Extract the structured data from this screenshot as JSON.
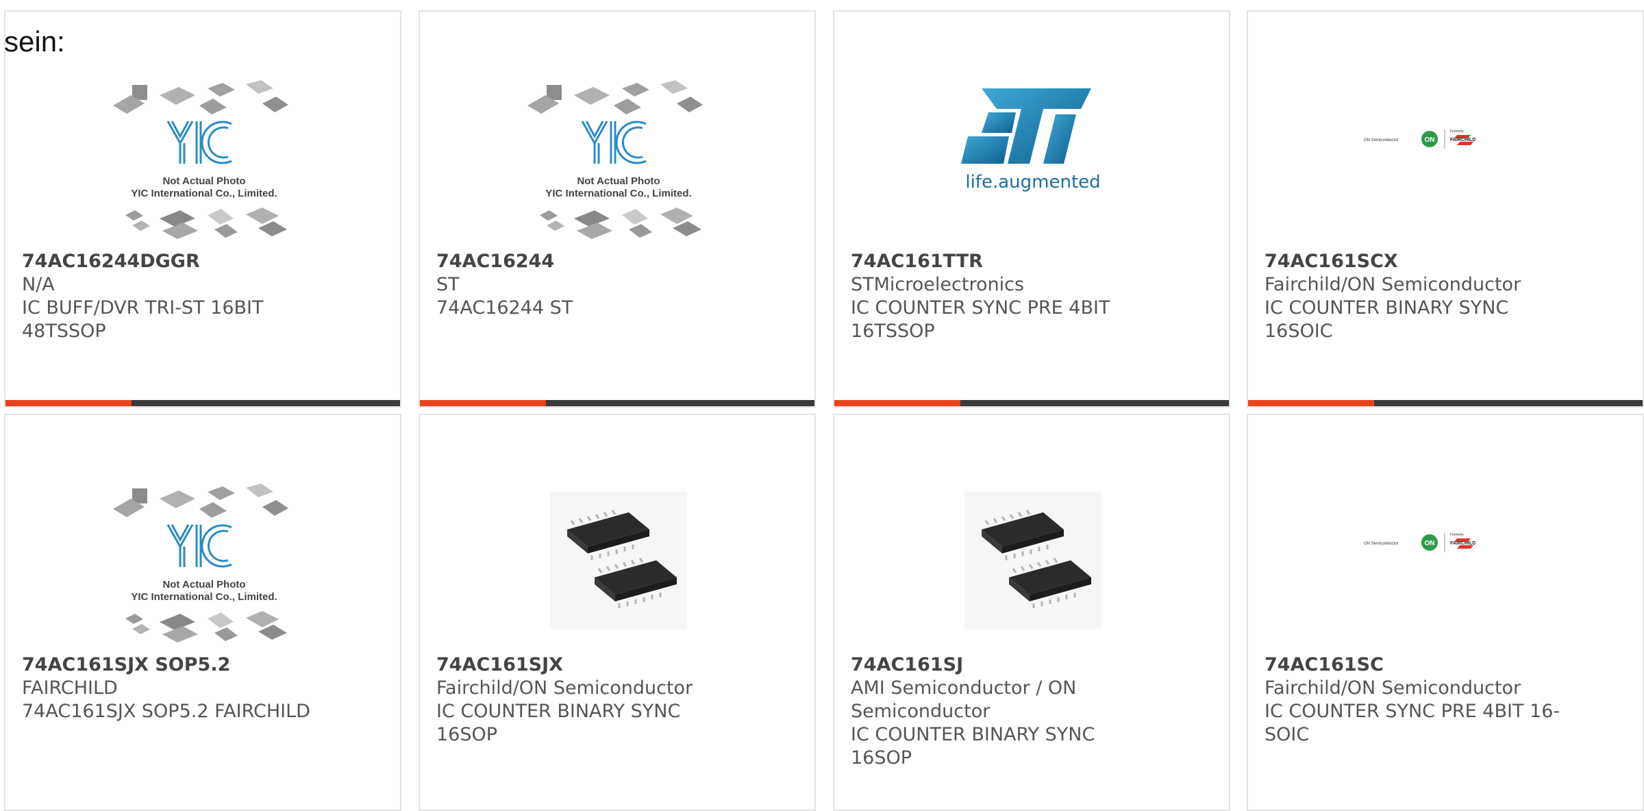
{
  "lead_text": "sein:",
  "brand_colors": {
    "accent": "#e8441b",
    "bar_dark": "#3a3a3a",
    "st_blue": "#1b6fa0",
    "on_green": "#2e9a48",
    "fairchild_red": "#e5322d"
  },
  "placeholder_image": {
    "line1": "Not Actual Photo",
    "line2": "YIC International Co., Limited."
  },
  "st_logo": {
    "tagline": "life.augmented"
  },
  "onsemi_logo": {
    "left": "ON Semiconductor",
    "formerly": "Formerly",
    "right": "FAIRCHILD"
  },
  "products": [
    {
      "part": "74AC16244DGGR",
      "maker": "N/A",
      "desc": [
        "IC BUFF/DVR TRI-ST 16BIT",
        "48TSSOP"
      ],
      "image": "yic-placeholder-image"
    },
    {
      "part": "74AC16244",
      "maker": "ST",
      "desc": [
        "74AC16244 ST"
      ],
      "image": "yic-placeholder-image"
    },
    {
      "part": "74AC161TTR",
      "maker": "STMicroelectronics",
      "desc": [
        "IC COUNTER SYNC PRE 4BIT",
        "16TSSOP"
      ],
      "image": "st-logo"
    },
    {
      "part": "74AC161SCX",
      "maker": "Fairchild/ON Semiconductor",
      "desc": [
        "IC COUNTER BINARY SYNC",
        "16SOIC"
      ],
      "image": "onsemi-fairchild-logo"
    },
    {
      "part": "74AC161SJX SOP5.2",
      "maker": "FAIRCHILD",
      "desc": [
        "74AC161SJX SOP5.2 FAIRCHILD"
      ],
      "image": "yic-placeholder-image"
    },
    {
      "part": "74AC161SJX",
      "maker": "Fairchild/ON Semiconductor",
      "desc": [
        "IC COUNTER BINARY SYNC",
        "16SOP"
      ],
      "image": "soic-chip-photo"
    },
    {
      "part": "74AC161SJ",
      "maker": "AMI Semiconductor / ON",
      "maker2": "Semiconductor",
      "desc": [
        "IC COUNTER BINARY SYNC",
        "16SOP"
      ],
      "image": "soic-chip-photo"
    },
    {
      "part": "74AC161SC",
      "maker": "Fairchild/ON Semiconductor",
      "desc": [
        "IC COUNTER SYNC PRE 4BIT 16-",
        "SOIC"
      ],
      "image": "onsemi-fairchild-logo"
    }
  ]
}
